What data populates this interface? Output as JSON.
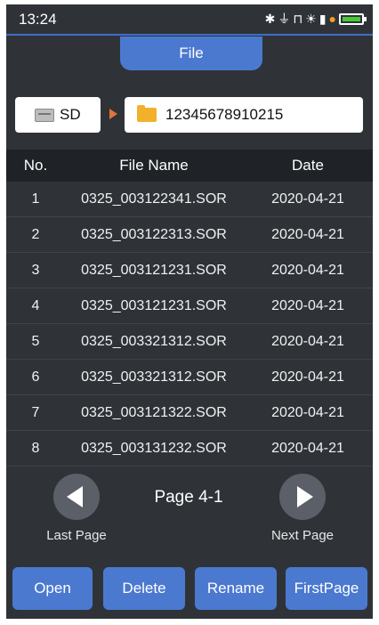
{
  "status": {
    "time": "13:24",
    "icons": [
      "bluetooth-icon",
      "usb-icon",
      "plug-icon",
      "sun-icon",
      "sdcard-icon",
      "charging-icon",
      "battery-icon"
    ]
  },
  "header": {
    "title": "File"
  },
  "location": {
    "drive": "SD",
    "folder": "12345678910215"
  },
  "table": {
    "columns": [
      "No.",
      "File Name",
      "Date"
    ],
    "rows": [
      [
        "1",
        "0325_003122341.SOR",
        "2020-04-21"
      ],
      [
        "2",
        "0325_003122313.SOR",
        "2020-04-21"
      ],
      [
        "3",
        "0325_003121231.SOR",
        "2020-04-21"
      ],
      [
        "4",
        "0325_003121231.SOR",
        "2020-04-21"
      ],
      [
        "5",
        "0325_003321312.SOR",
        "2020-04-21"
      ],
      [
        "6",
        "0325_003321312.SOR",
        "2020-04-21"
      ],
      [
        "7",
        "0325_003121322.SOR",
        "2020-04-21"
      ],
      [
        "8",
        "0325_003131232.SOR",
        "2020-04-21"
      ]
    ]
  },
  "pager": {
    "page_label": "Page 4-1",
    "last_label": "Last Page",
    "next_label": "Next Page"
  },
  "actions": {
    "open": "Open",
    "delete": "Delete",
    "rename": "Rename",
    "first_page": "FirstPage"
  },
  "colors": {
    "accent": "#4b79cf",
    "background": "#2f3338",
    "header_row": "#1f2226",
    "folder": "#f2b12a",
    "battery": "#47c93a"
  }
}
